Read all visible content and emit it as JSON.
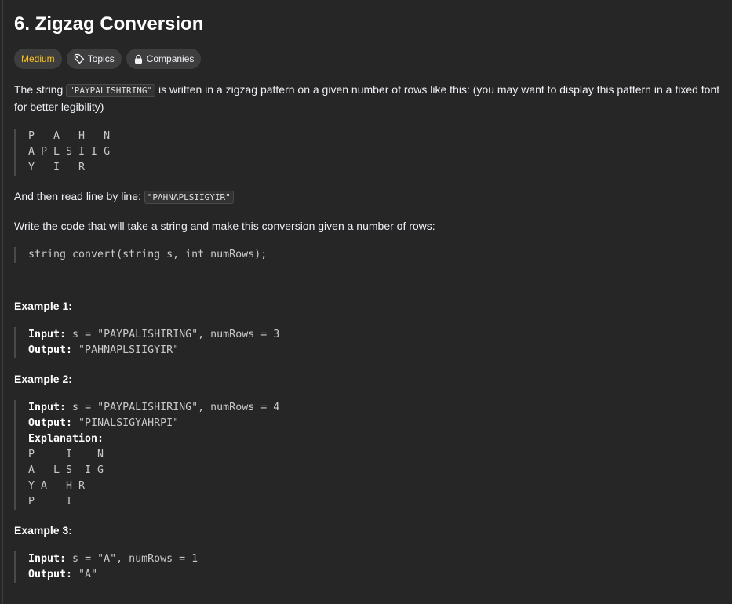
{
  "problem": {
    "title": "6. Zigzag Conversion",
    "difficulty": "Medium",
    "topics_label": "Topics",
    "companies_label": "Companies"
  },
  "description": {
    "p1_before": "The string ",
    "p1_code": "\"PAYPALISHIRING\"",
    "p1_after": " is written in a zigzag pattern on a given number of rows like this: (you may want to display this pattern in a fixed font for better legibility)",
    "zigzag": "P   A   H   N\nA P L S I I G\nY   I   R",
    "p2_before": "And then read line by line: ",
    "p2_code": "\"PAHNAPLSIIGYIR\"",
    "p3": "Write the code that will take a string and make this conversion given a number of rows:",
    "signature": "string convert(string s, int numRows);"
  },
  "examples": [
    {
      "heading": "Example 1:",
      "input_label": "Input:",
      "input_value": " s = \"PAYPALISHIRING\", numRows = 3",
      "output_label": "Output:",
      "output_value": " \"PAHNAPLSIIGYIR\""
    },
    {
      "heading": "Example 2:",
      "input_label": "Input:",
      "input_value": " s = \"PAYPALISHIRING\", numRows = 4",
      "output_label": "Output:",
      "output_value": " \"PINALSIGYAHRPI\"",
      "explanation_label": "Explanation:",
      "explanation_pattern": "P     I    N\nA   L S  I G\nY A   H R\nP     I"
    },
    {
      "heading": "Example 3:",
      "input_label": "Input:",
      "input_value": " s = \"A\", numRows = 1",
      "output_label": "Output:",
      "output_value": " \"A\""
    }
  ],
  "colors": {
    "background": "#262626",
    "difficulty_medium": "#ffc01e",
    "tag_bg": "#3e3e3e"
  },
  "icons": [
    "tag-icon",
    "lock-icon"
  ]
}
